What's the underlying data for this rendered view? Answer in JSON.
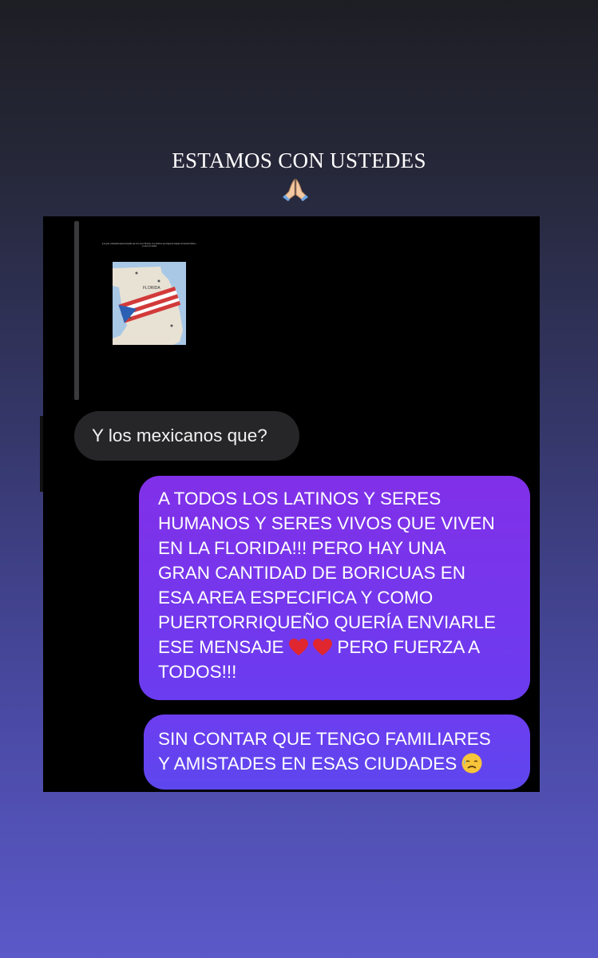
{
  "story": {
    "headline": "ESTAMOS CON USTEDES",
    "headline_emoji": "folded-hands-icon",
    "bg_top": "#1d1e24",
    "bg_bottom": "#5b59c8"
  },
  "chat": {
    "shared_post": {
      "caption": "A la gran comunidad puertorriqueña que vive en la Florida, a los muchos que llegaron después de huracán María... y todos los demás",
      "map_label": "FLORIDA"
    },
    "received": {
      "text": "Y los mexicanos que?"
    },
    "sent": [
      {
        "lines": [
          "A TODOS LOS LATINOS Y SERES",
          "HUMANOS Y SERES VIVOS QUE VIVEN",
          "EN LA FLORIDA!!! PERO HAY UNA",
          "GRAN CANTIDAD DE BORICUAS EN",
          "ESA AREA ESPECIFICA Y COMO",
          "PUERTORRIQUEÑO QUERÍA ENVIARLE"
        ],
        "line7_before": "ESE MENSAJE ",
        "line7_after": "  PERO FUERZA A",
        "line8": "TODOS!!!",
        "emoji": "red-heart-icon",
        "color": "#7a35ec"
      },
      {
        "lines": [
          "SIN CONTAR QUE TENGO FAMILIARES"
        ],
        "line2": "Y AMISTADES EN ESAS CIUDADES",
        "emoji": "sad-relieved-face-icon",
        "color": "#6642ef"
      }
    ]
  }
}
